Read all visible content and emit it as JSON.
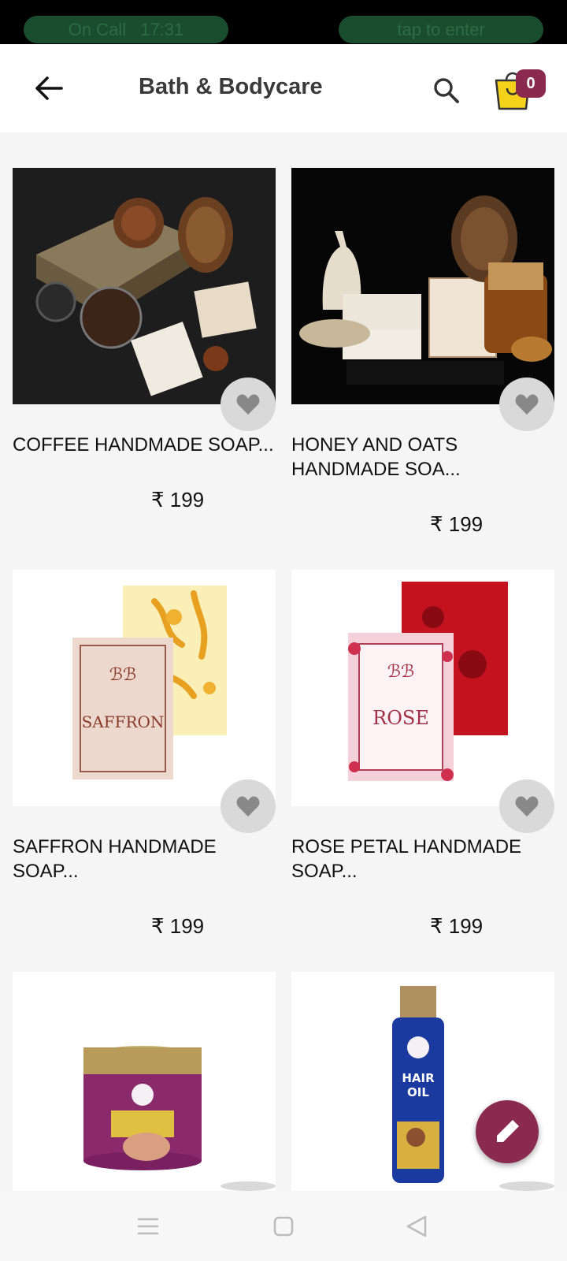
{
  "status_bar": {
    "call_label": "On Call",
    "call_time": "17:31",
    "tap_label": "tap to enter"
  },
  "app_bar": {
    "title": "Bath & Bodycare",
    "back_icon": "arrow-left-icon",
    "search_icon": "search-icon",
    "cart_icon": "shopping-bag-icon",
    "cart_count": "0"
  },
  "colors": {
    "accent": "#8b2a4f",
    "cart_yellow": "#f5d21a",
    "background": "#f5f5f5"
  },
  "products": [
    {
      "name": "COFFEE HANDMADE SOAP...",
      "price": "₹ 199"
    },
    {
      "name": "HONEY AND OATS HANDMADE SOA...",
      "price": "₹ 199"
    },
    {
      "name": "SAFFRON HANDMADE SOAP...",
      "price": "₹ 199"
    },
    {
      "name": "ROSE PETAL HANDMADE SOAP...",
      "price": "₹ 199"
    },
    {
      "name": "",
      "price": ""
    },
    {
      "name": "",
      "price": ""
    }
  ],
  "fab": {
    "icon": "edit-pen-icon"
  },
  "nav": {
    "menu_icon": "menu-icon",
    "home_icon": "square-home-icon",
    "back_icon": "triangle-back-icon"
  }
}
